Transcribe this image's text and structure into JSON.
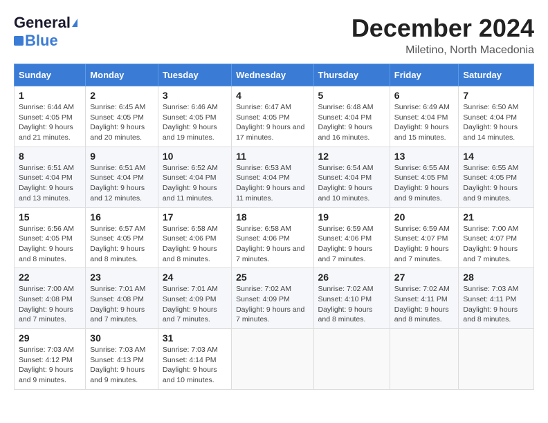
{
  "header": {
    "logo_general": "General",
    "logo_blue": "Blue",
    "month_title": "December 2024",
    "location": "Miletino, North Macedonia"
  },
  "calendar": {
    "days_of_week": [
      "Sunday",
      "Monday",
      "Tuesday",
      "Wednesday",
      "Thursday",
      "Friday",
      "Saturday"
    ],
    "weeks": [
      [
        {
          "day": "1",
          "sunrise": "Sunrise: 6:44 AM",
          "sunset": "Sunset: 4:05 PM",
          "daylight": "Daylight: 9 hours and 21 minutes."
        },
        {
          "day": "2",
          "sunrise": "Sunrise: 6:45 AM",
          "sunset": "Sunset: 4:05 PM",
          "daylight": "Daylight: 9 hours and 20 minutes."
        },
        {
          "day": "3",
          "sunrise": "Sunrise: 6:46 AM",
          "sunset": "Sunset: 4:05 PM",
          "daylight": "Daylight: 9 hours and 19 minutes."
        },
        {
          "day": "4",
          "sunrise": "Sunrise: 6:47 AM",
          "sunset": "Sunset: 4:05 PM",
          "daylight": "Daylight: 9 hours and 17 minutes."
        },
        {
          "day": "5",
          "sunrise": "Sunrise: 6:48 AM",
          "sunset": "Sunset: 4:04 PM",
          "daylight": "Daylight: 9 hours and 16 minutes."
        },
        {
          "day": "6",
          "sunrise": "Sunrise: 6:49 AM",
          "sunset": "Sunset: 4:04 PM",
          "daylight": "Daylight: 9 hours and 15 minutes."
        },
        {
          "day": "7",
          "sunrise": "Sunrise: 6:50 AM",
          "sunset": "Sunset: 4:04 PM",
          "daylight": "Daylight: 9 hours and 14 minutes."
        }
      ],
      [
        {
          "day": "8",
          "sunrise": "Sunrise: 6:51 AM",
          "sunset": "Sunset: 4:04 PM",
          "daylight": "Daylight: 9 hours and 13 minutes."
        },
        {
          "day": "9",
          "sunrise": "Sunrise: 6:51 AM",
          "sunset": "Sunset: 4:04 PM",
          "daylight": "Daylight: 9 hours and 12 minutes."
        },
        {
          "day": "10",
          "sunrise": "Sunrise: 6:52 AM",
          "sunset": "Sunset: 4:04 PM",
          "daylight": "Daylight: 9 hours and 11 minutes."
        },
        {
          "day": "11",
          "sunrise": "Sunrise: 6:53 AM",
          "sunset": "Sunset: 4:04 PM",
          "daylight": "Daylight: 9 hours and 11 minutes."
        },
        {
          "day": "12",
          "sunrise": "Sunrise: 6:54 AM",
          "sunset": "Sunset: 4:04 PM",
          "daylight": "Daylight: 9 hours and 10 minutes."
        },
        {
          "day": "13",
          "sunrise": "Sunrise: 6:55 AM",
          "sunset": "Sunset: 4:05 PM",
          "daylight": "Daylight: 9 hours and 9 minutes."
        },
        {
          "day": "14",
          "sunrise": "Sunrise: 6:55 AM",
          "sunset": "Sunset: 4:05 PM",
          "daylight": "Daylight: 9 hours and 9 minutes."
        }
      ],
      [
        {
          "day": "15",
          "sunrise": "Sunrise: 6:56 AM",
          "sunset": "Sunset: 4:05 PM",
          "daylight": "Daylight: 9 hours and 8 minutes."
        },
        {
          "day": "16",
          "sunrise": "Sunrise: 6:57 AM",
          "sunset": "Sunset: 4:05 PM",
          "daylight": "Daylight: 9 hours and 8 minutes."
        },
        {
          "day": "17",
          "sunrise": "Sunrise: 6:58 AM",
          "sunset": "Sunset: 4:06 PM",
          "daylight": "Daylight: 9 hours and 8 minutes."
        },
        {
          "day": "18",
          "sunrise": "Sunrise: 6:58 AM",
          "sunset": "Sunset: 4:06 PM",
          "daylight": "Daylight: 9 hours and 7 minutes."
        },
        {
          "day": "19",
          "sunrise": "Sunrise: 6:59 AM",
          "sunset": "Sunset: 4:06 PM",
          "daylight": "Daylight: 9 hours and 7 minutes."
        },
        {
          "day": "20",
          "sunrise": "Sunrise: 6:59 AM",
          "sunset": "Sunset: 4:07 PM",
          "daylight": "Daylight: 9 hours and 7 minutes."
        },
        {
          "day": "21",
          "sunrise": "Sunrise: 7:00 AM",
          "sunset": "Sunset: 4:07 PM",
          "daylight": "Daylight: 9 hours and 7 minutes."
        }
      ],
      [
        {
          "day": "22",
          "sunrise": "Sunrise: 7:00 AM",
          "sunset": "Sunset: 4:08 PM",
          "daylight": "Daylight: 9 hours and 7 minutes."
        },
        {
          "day": "23",
          "sunrise": "Sunrise: 7:01 AM",
          "sunset": "Sunset: 4:08 PM",
          "daylight": "Daylight: 9 hours and 7 minutes."
        },
        {
          "day": "24",
          "sunrise": "Sunrise: 7:01 AM",
          "sunset": "Sunset: 4:09 PM",
          "daylight": "Daylight: 9 hours and 7 minutes."
        },
        {
          "day": "25",
          "sunrise": "Sunrise: 7:02 AM",
          "sunset": "Sunset: 4:09 PM",
          "daylight": "Daylight: 9 hours and 7 minutes."
        },
        {
          "day": "26",
          "sunrise": "Sunrise: 7:02 AM",
          "sunset": "Sunset: 4:10 PM",
          "daylight": "Daylight: 9 hours and 8 minutes."
        },
        {
          "day": "27",
          "sunrise": "Sunrise: 7:02 AM",
          "sunset": "Sunset: 4:11 PM",
          "daylight": "Daylight: 9 hours and 8 minutes."
        },
        {
          "day": "28",
          "sunrise": "Sunrise: 7:03 AM",
          "sunset": "Sunset: 4:11 PM",
          "daylight": "Daylight: 9 hours and 8 minutes."
        }
      ],
      [
        {
          "day": "29",
          "sunrise": "Sunrise: 7:03 AM",
          "sunset": "Sunset: 4:12 PM",
          "daylight": "Daylight: 9 hours and 9 minutes."
        },
        {
          "day": "30",
          "sunrise": "Sunrise: 7:03 AM",
          "sunset": "Sunset: 4:13 PM",
          "daylight": "Daylight: 9 hours and 9 minutes."
        },
        {
          "day": "31",
          "sunrise": "Sunrise: 7:03 AM",
          "sunset": "Sunset: 4:14 PM",
          "daylight": "Daylight: 9 hours and 10 minutes."
        },
        null,
        null,
        null,
        null
      ]
    ]
  }
}
